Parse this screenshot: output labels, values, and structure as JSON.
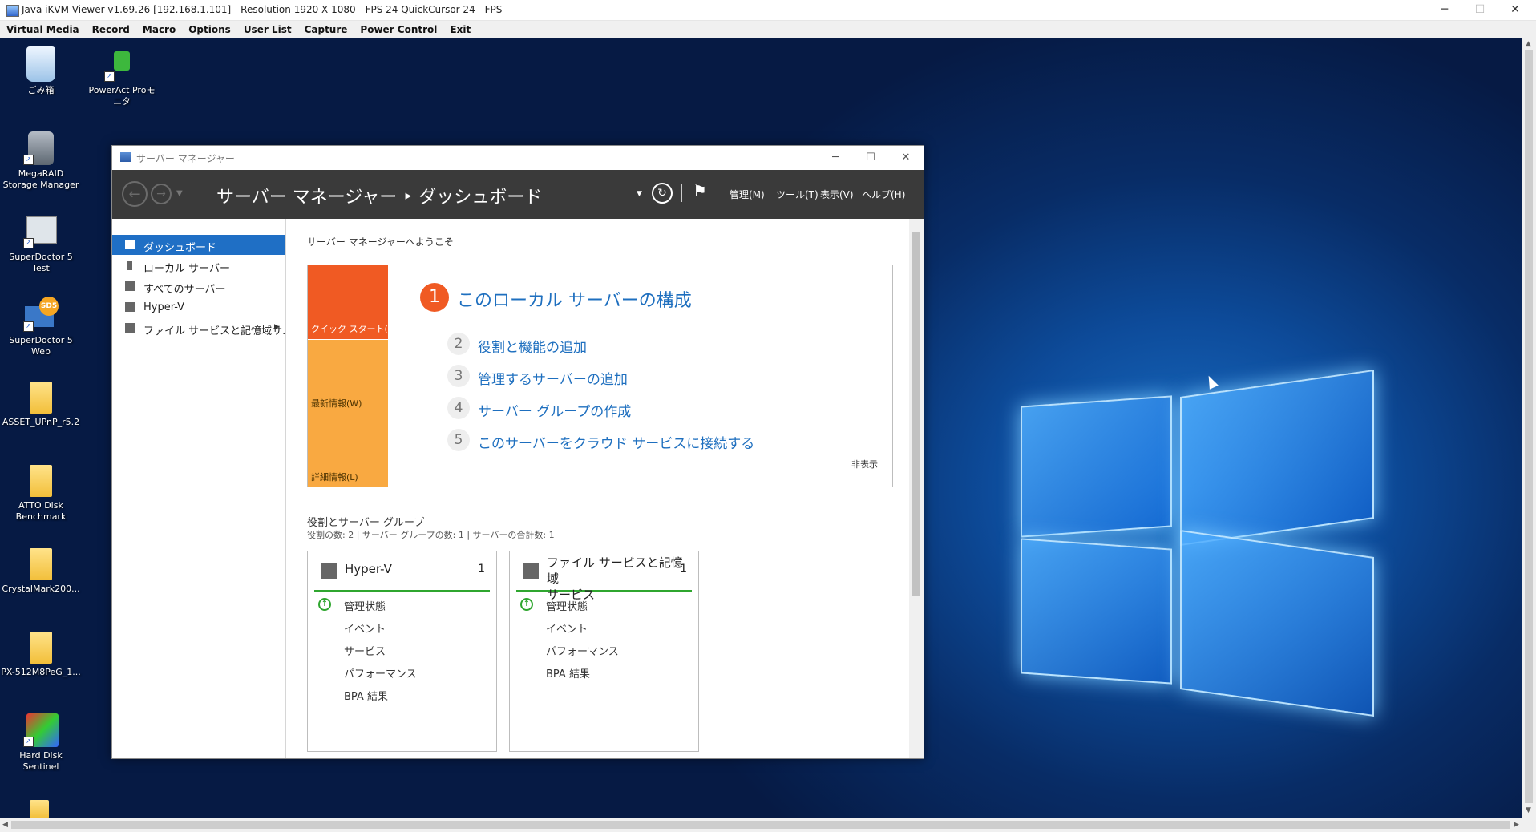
{
  "java_window": {
    "title": "Java iKVM Viewer v1.69.26 [192.168.1.101]  - Resolution 1920 X 1080 - FPS 24 QuickCursor 24 - FPS",
    "menu": [
      "Virtual Media",
      "Record",
      "Macro",
      "Options",
      "User List",
      "Capture",
      "Power Control",
      "Exit"
    ]
  },
  "desktop_icons": [
    {
      "label": "ごみ箱",
      "icon": "recycle-bin-icon"
    },
    {
      "label": "PowerAct Proモニタ",
      "icon": "power-plug-icon"
    },
    {
      "label": "MegaRAID\nStorage Manager",
      "icon": "database-icon"
    },
    {
      "label": "SuperDoctor 5\nTest",
      "icon": "gear-icon"
    },
    {
      "label": "SuperDoctor 5\nWeb",
      "icon": "sd5-icon"
    },
    {
      "label": "ASSET_UPnP_r5.2",
      "icon": "folder-icon"
    },
    {
      "label": "ATTO Disk\nBenchmark",
      "icon": "folder-icon"
    },
    {
      "label": "CrystalMark200...",
      "icon": "folder-icon"
    },
    {
      "label": "PX-512M8PeG_1...",
      "icon": "folder-icon"
    },
    {
      "label": "Hard Disk Sentinel",
      "icon": "hard-disk-icon"
    }
  ],
  "server_manager": {
    "window_title": "サーバー マネージャー",
    "breadcrumb": "サーバー マネージャー ‣ ダッシュボード",
    "menu": [
      "管理(M)",
      "ツール(T)",
      "表示(V)",
      "ヘルプ(H)"
    ],
    "sidebar": [
      "ダッシュボード",
      "ローカル サーバー",
      "すべてのサーバー",
      "Hyper-V",
      "ファイル サービスと記憶域サ..."
    ],
    "welcome": "サーバー マネージャーへようこそ",
    "quick_tabs": [
      "クイック スタート(Q)",
      "最新情報(W)",
      "詳細情報(L)"
    ],
    "steps": [
      {
        "num": "1",
        "label": "このローカル サーバーの構成"
      },
      {
        "num": "2",
        "label": "役割と機能の追加"
      },
      {
        "num": "3",
        "label": "管理するサーバーの追加"
      },
      {
        "num": "4",
        "label": "サーバー グループの作成"
      },
      {
        "num": "5",
        "label": "このサーバーをクラウド サービスに接続する"
      }
    ],
    "hide_label": "非表示",
    "roles_title": "役割とサーバー グループ",
    "roles_summary": "役割の数: 2  |  サーバー グループの数: 1  |  サーバーの合計数: 1",
    "cards": [
      {
        "title": "Hyper-V",
        "count": "1",
        "items": [
          "管理状態",
          "イベント",
          "サービス",
          "パフォーマンス",
          "BPA 結果"
        ]
      },
      {
        "title": "ファイル サービスと記憶域\nサービス",
        "count": "1",
        "items": [
          "管理状態",
          "イベント",
          "パフォーマンス",
          "BPA 結果"
        ]
      }
    ]
  },
  "colors": {
    "accent": "#1f6fc5",
    "orange": "#f05a23",
    "tab_light": "#f9a941",
    "ok_green": "#2fa62f",
    "header_dark": "#3a3a3a"
  }
}
